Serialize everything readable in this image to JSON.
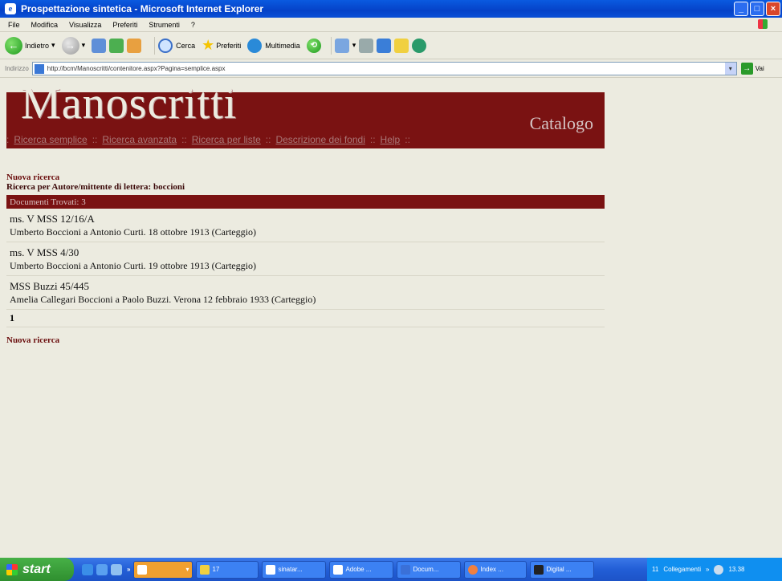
{
  "window": {
    "title": "Prospettazione sintetica - Microsoft Internet Explorer"
  },
  "menu": [
    "File",
    "Modifica",
    "Visualizza",
    "Preferiti",
    "Strumenti",
    "?"
  ],
  "toolbar": {
    "back": "Indietro",
    "search": "Cerca",
    "favorites": "Preferiti",
    "media": "Multimedia"
  },
  "address": {
    "label": "Indirizzo",
    "url": "http://bcm/Manoscritti/contenitore.aspx?Pagina=semplice.aspx",
    "go": "Vai"
  },
  "banner": {
    "title": "Manoscritti",
    "subtitle": "Catalogo"
  },
  "nav": [
    "Ricerca semplice",
    "Ricerca avanzata",
    "Ricerca per liste",
    "Descrizione dei fondi",
    "Help"
  ],
  "search": {
    "new_search": "Nuova ricerca",
    "query": "Ricerca per Autore/mittente di lettera: boccioni"
  },
  "results": {
    "header": "Documenti Trovati: 3",
    "rows": [
      {
        "shelfmark": "ms. V MSS 12/16/A",
        "desc": "Umberto Boccioni a Antonio Curti. 18 ottobre 1913 (Carteggio)"
      },
      {
        "shelfmark": "ms. V MSS 4/30",
        "desc": "Umberto Boccioni a Antonio Curti. 19 ottobre 1913 (Carteggio)"
      },
      {
        "shelfmark": "MSS Buzzi 45/445",
        "desc": "Amelia Callegari Boccioni a Paolo Buzzi. Verona 12 febbraio 1933 (Carteggio)"
      }
    ],
    "page": "1",
    "new_search_bottom": "Nuova ricerca"
  },
  "taskbar": {
    "start": "start",
    "tasks": [
      "17",
      "sinatar...",
      "Adobe ...",
      "Docum...",
      "Index ...",
      "Digital ..."
    ],
    "tray_num": "11",
    "links": "Collegamenti",
    "clock": "13.38"
  }
}
